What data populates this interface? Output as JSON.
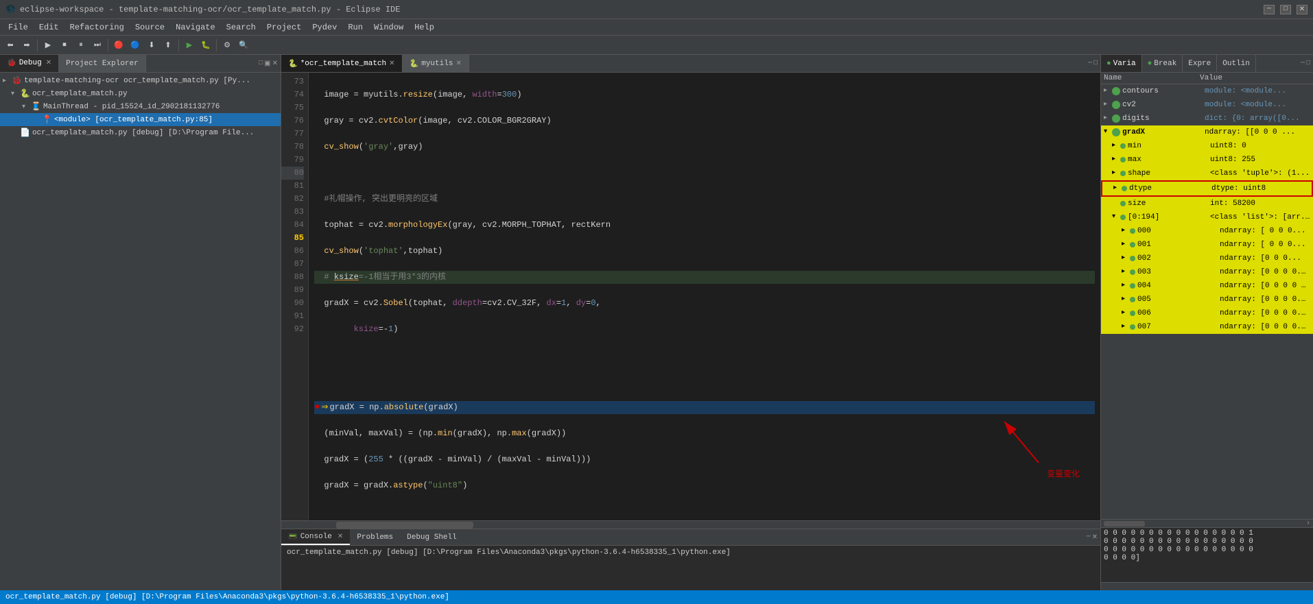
{
  "title_bar": {
    "text": "eclipse-workspace - template-matching-ocr/ocr_template_match.py - Eclipse IDE",
    "buttons": [
      "minimize",
      "maximize",
      "close"
    ]
  },
  "menu": {
    "items": [
      "File",
      "Edit",
      "Refactoring",
      "Source",
      "Navigate",
      "Search",
      "Project",
      "Pydev",
      "Run",
      "Window",
      "Help"
    ]
  },
  "left_panel": {
    "tabs": [
      {
        "label": "Debug",
        "active": true,
        "closable": true
      },
      {
        "label": "Project Explorer",
        "active": false,
        "closable": false
      }
    ],
    "tree": [
      {
        "indent": 0,
        "arrow": "▸",
        "icon": "🐞",
        "label": "template-matching-ocr ocr_template_match.py [Py..."
      },
      {
        "indent": 1,
        "arrow": "▾",
        "icon": "📄",
        "label": "ocr_template_match.py"
      },
      {
        "indent": 2,
        "arrow": "▾",
        "icon": "🧵",
        "label": "MainThread - pid_15524_id_2902181132776"
      },
      {
        "indent": 3,
        "arrow": "",
        "icon": "📍",
        "label": "<module> [ocr_template_match.py:85]",
        "selected": true
      },
      {
        "indent": 1,
        "arrow": "",
        "icon": "📄",
        "label": "ocr_template_match.py [debug] [D:\\Program File..."
      }
    ]
  },
  "editor": {
    "tabs": [
      {
        "label": "*ocr_template_match",
        "active": true,
        "closable": true
      },
      {
        "label": "myutils",
        "active": false,
        "closable": true
      }
    ],
    "lines": [
      {
        "num": 73,
        "code": "image = myutils.resize(image, width=300)",
        "type": "normal"
      },
      {
        "num": 74,
        "code": "gray = cv2.cvtColor(image, cv2.COLOR_BGR2GRAY)",
        "type": "normal"
      },
      {
        "num": 75,
        "code": "cv_show('gray',gray)",
        "type": "normal"
      },
      {
        "num": 76,
        "code": "",
        "type": "normal"
      },
      {
        "num": 77,
        "code": "#礼帽操作, 突出更明亮的区域",
        "type": "comment"
      },
      {
        "num": 78,
        "code": "tophat = cv2.morphologyEx(gray, cv2.MORPH_TOPHAT, rectKern",
        "type": "normal"
      },
      {
        "num": 79,
        "code": "cv_show('tophat',tophat)",
        "type": "normal"
      },
      {
        "num": 80,
        "code": "# ksize=-1相当于用3*3的内核",
        "type": "comment"
      },
      {
        "num": 81,
        "code": "gradX = cv2.Sobel(tophat, ddepth=cv2.CV_32F, dx=1, dy=0,",
        "type": "normal"
      },
      {
        "num": 82,
        "code": "    ksize=-1)",
        "type": "normal"
      },
      {
        "num": 83,
        "code": "",
        "type": "normal"
      },
      {
        "num": 84,
        "code": "",
        "type": "normal"
      },
      {
        "num": 85,
        "code": "gradX = np.absolute(gradX)",
        "type": "current",
        "breakpoint": true
      },
      {
        "num": 86,
        "code": "(minVal, maxVal) = (np.min(gradX), np.max(gradX))",
        "type": "normal"
      },
      {
        "num": 87,
        "code": "gradX = (255 * ((gradX - minVal) / (maxVal - minVal)))",
        "type": "normal"
      },
      {
        "num": 88,
        "code": "gradX = gradX.astype(\"uint8\")",
        "type": "normal"
      },
      {
        "num": 89,
        "code": "",
        "type": "normal"
      },
      {
        "num": 90,
        "code": "print (np.array(gradX).shape)",
        "type": "normal"
      },
      {
        "num": 91,
        "code": "cv_show('gradX',gradX)",
        "type": "normal"
      },
      {
        "num": 92,
        "code": "",
        "type": "normal"
      }
    ]
  },
  "right_panel": {
    "tabs": [
      {
        "label": "Varia",
        "active": true,
        "dot": true
      },
      {
        "label": "Break",
        "active": false,
        "dot": true
      },
      {
        "label": "Expre",
        "active": false
      },
      {
        "label": "Outlin",
        "active": false
      }
    ],
    "header": {
      "name": "Name",
      "value": "Value"
    },
    "variables": [
      {
        "indent": 0,
        "arrow": "▸",
        "has_icon": true,
        "name": "contours",
        "value": "module: <module...",
        "highlight": false
      },
      {
        "indent": 0,
        "arrow": "▸",
        "has_icon": true,
        "name": "cv2",
        "value": "module: <module...",
        "highlight": false
      },
      {
        "indent": 0,
        "arrow": "▸",
        "has_icon": true,
        "name": "digits",
        "value": "dict: {0: array([0...",
        "highlight": false
      },
      {
        "indent": 0,
        "arrow": "▾",
        "has_icon": true,
        "name": "gradX",
        "value": "ndarray: [[0 0 0 ...",
        "highlight": true
      },
      {
        "indent": 1,
        "arrow": "▸",
        "has_icon": true,
        "name": "min",
        "value": "uint8: 0",
        "highlight": true
      },
      {
        "indent": 1,
        "arrow": "▸",
        "has_icon": true,
        "name": "max",
        "value": "uint8: 255",
        "highlight": true
      },
      {
        "indent": 1,
        "arrow": "▸",
        "has_icon": true,
        "name": "shape",
        "value": "<class 'tuple'>: (1...",
        "highlight": true
      },
      {
        "indent": 1,
        "arrow": "▸",
        "has_icon": true,
        "name": "dtype",
        "value": "dtype: uint8",
        "highlight": true,
        "red_border": true
      },
      {
        "indent": 1,
        "arrow": "▸",
        "has_icon": true,
        "name": "size",
        "value": "int: 58200",
        "highlight": true
      },
      {
        "indent": 1,
        "arrow": "▾",
        "has_icon": true,
        "name": "[0:194]",
        "value": "<class 'list'>: [arr...",
        "highlight": true
      },
      {
        "indent": 2,
        "arrow": "▸",
        "has_icon": true,
        "name": "000",
        "value": "ndarray: [ 0  0  0...",
        "highlight": true
      },
      {
        "indent": 2,
        "arrow": "▸",
        "has_icon": true,
        "name": "001",
        "value": "ndarray: [ 0 0 0...",
        "highlight": true
      },
      {
        "indent": 2,
        "arrow": "▸",
        "has_icon": true,
        "name": "002",
        "value": "ndarray: [0 0 0...",
        "highlight": true
      },
      {
        "indent": 2,
        "arrow": "▸",
        "has_icon": true,
        "name": "003",
        "value": "ndarray: [0 0 0 0...",
        "highlight": true
      },
      {
        "indent": 2,
        "arrow": "▸",
        "has_icon": true,
        "name": "004",
        "value": "ndarray: [0 0 0 0 0...",
        "highlight": true
      },
      {
        "indent": 2,
        "arrow": "▸",
        "has_icon": true,
        "name": "005",
        "value": "ndarray: [0 0 0 0...",
        "highlight": true
      },
      {
        "indent": 2,
        "arrow": "▸",
        "has_icon": true,
        "name": "006",
        "value": "ndarray: [0 0 0 0...",
        "highlight": true
      },
      {
        "indent": 2,
        "arrow": "▸",
        "has_icon": true,
        "name": "007",
        "value": "ndarray: [0 0 0 0...",
        "highlight": true
      }
    ],
    "bottom_data": "0 0 0 0 0 0 0 0 0 0 0 0 0 0 0 0 1\n0 0 0 0 0 0 0 0 0 0 0 0 0 0 0 0 0\n0 0 0 0 0 0 0 0 0 0 0 0 0 0 0 0 0\n0 0 0 0]"
  },
  "bottom_panel": {
    "tabs": [
      {
        "label": "Console",
        "active": true,
        "closable": true
      },
      {
        "label": "Problems",
        "active": false
      },
      {
        "label": "Debug Shell",
        "active": false
      }
    ],
    "content": "ocr_template_match.py [debug] [D:\\Program Files\\Anaconda3\\pkgs\\python-3.6.4-h6538335_1\\python.exe]"
  },
  "annotation": {
    "label": "变量变化"
  }
}
